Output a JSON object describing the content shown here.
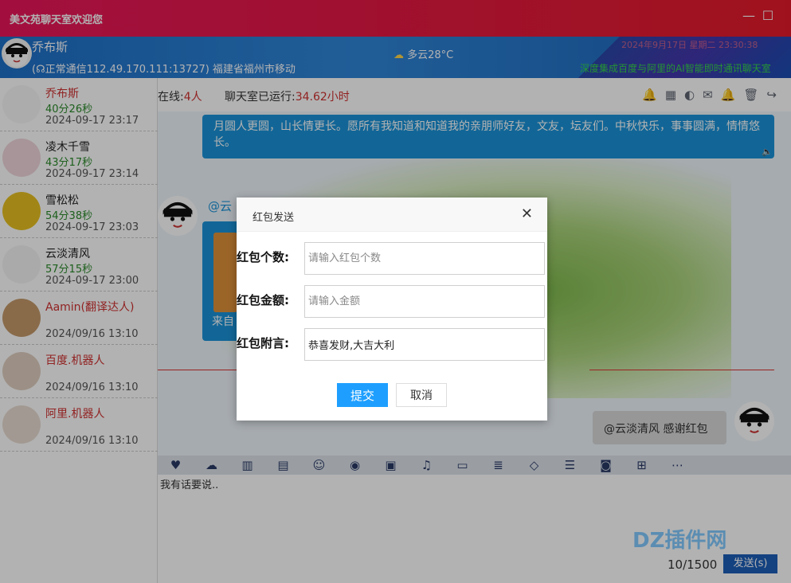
{
  "window": {
    "title": "美文苑聊天室欢迎您",
    "minimize": "—",
    "maximize": "☐"
  },
  "header": {
    "username": "乔布斯",
    "connection": "(☊正常通信112.49.170.111:13727)  福建省福州市移动",
    "weather": "多云28°C",
    "marquee": "深度集成百度与阿里的AI智能即时通讯聊天室",
    "top_right_text": "2024年9月17日  星期二  23:30:38"
  },
  "users": [
    {
      "name": "乔布斯",
      "duration": "40分26秒",
      "time": "2024-09-17 23:17",
      "name_color": "#d03030"
    },
    {
      "name": "凌木千雪",
      "duration": "43分17秒",
      "time": "2024-09-17 23:14",
      "name_color": "#222"
    },
    {
      "name": "雪松松",
      "duration": "54分38秒",
      "time": "2024-09-17 23:03",
      "name_color": "#222"
    },
    {
      "name": "云淡清风",
      "duration": "57分15秒",
      "time": "2024-09-17 23:00",
      "name_color": "#222"
    },
    {
      "name": "Aamin(翻译达人)",
      "duration": "",
      "time": "2024/09/16 13:10",
      "name_color": "#d03030"
    },
    {
      "name": "百度.机器人",
      "duration": "",
      "time": "2024/09/16 13:10",
      "name_color": "#d03030"
    },
    {
      "name": "阿里.机器人",
      "duration": "",
      "time": "2024/09/16 13:10",
      "name_color": "#d03030"
    }
  ],
  "topbar": {
    "online_label": "在线:",
    "online_count": "4人",
    "runtime_label": "聊天室已运行:",
    "runtime_value": "34.62小时"
  },
  "messages": {
    "m1": "月圆人更圆，山长情更长。愿所有我知道和知道我的亲朋师好友，文友，坛友们。中秋快乐，事事圆满，情情悠长。",
    "m2_name": "@云",
    "m2_text": "来自",
    "m3": "@云淡清风 感谢红包"
  },
  "input": {
    "placeholder": "我有话要说..",
    "counter": "10/1500",
    "send": "发送(s)"
  },
  "dialog": {
    "title": "红包发送",
    "count_label": "红包个数:",
    "count_placeholder": "请输入红包个数",
    "amount_label": "红包金额:",
    "amount_placeholder": "请输入金额",
    "note_label": "红包附言:",
    "note_value": "恭喜发财,大吉大利",
    "submit": "提交",
    "cancel": "取消"
  },
  "watermark": "DZ插件网",
  "colors": {
    "accent": "#1e9fff",
    "title_bar": "#e8165b",
    "header": "#1e70c8"
  }
}
